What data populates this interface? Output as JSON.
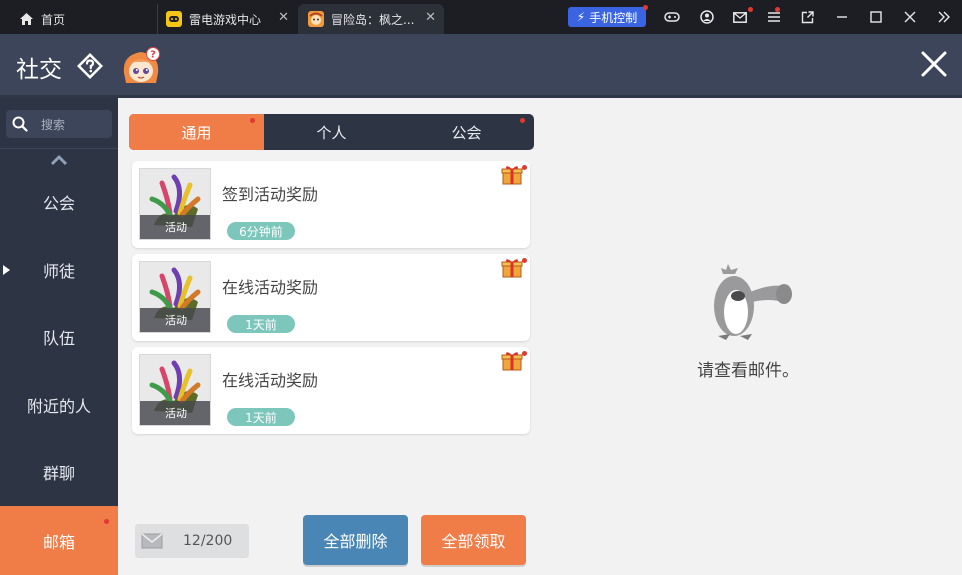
{
  "titlebar": {
    "tabs": [
      {
        "label": "首页"
      },
      {
        "label": "雷电游戏中心"
      },
      {
        "label": "冒险岛：枫之..."
      }
    ],
    "phone_control_label": "手机控制"
  },
  "header": {
    "title": "社交"
  },
  "sidebar": {
    "search_placeholder": "搜索",
    "items": [
      {
        "label": "公会"
      },
      {
        "label": "师徒"
      },
      {
        "label": "队伍"
      },
      {
        "label": "附近的人"
      },
      {
        "label": "群聊"
      },
      {
        "label": "邮箱"
      }
    ],
    "active_item": "邮箱"
  },
  "tabs": [
    {
      "label": "通用",
      "active": true,
      "badge": true
    },
    {
      "label": "个人",
      "active": false,
      "badge": false
    },
    {
      "label": "公会",
      "active": false,
      "badge": true
    }
  ],
  "mails": [
    {
      "title": "签到活动奖励",
      "time": "6分钟前",
      "thumb_label": "活动",
      "has_gift": true
    },
    {
      "title": "在线活动奖励",
      "time": "1天前",
      "thumb_label": "活动",
      "has_gift": true
    },
    {
      "title": "在线活动奖励",
      "time": "1天前",
      "thumb_label": "活动",
      "has_gift": true
    }
  ],
  "detail": {
    "empty_text": "请查看邮件。"
  },
  "footer": {
    "count": "12/200",
    "delete_all_label": "全部删除",
    "claim_all_label": "全部领取"
  },
  "colors": {
    "accent_orange": "#f07c48",
    "header_bg": "#3c4559",
    "sidebar_bg": "#2d3545",
    "delete_blue": "#4a86b5",
    "time_badge": "#7cc6bb",
    "badge_red": "#e03a2f"
  }
}
